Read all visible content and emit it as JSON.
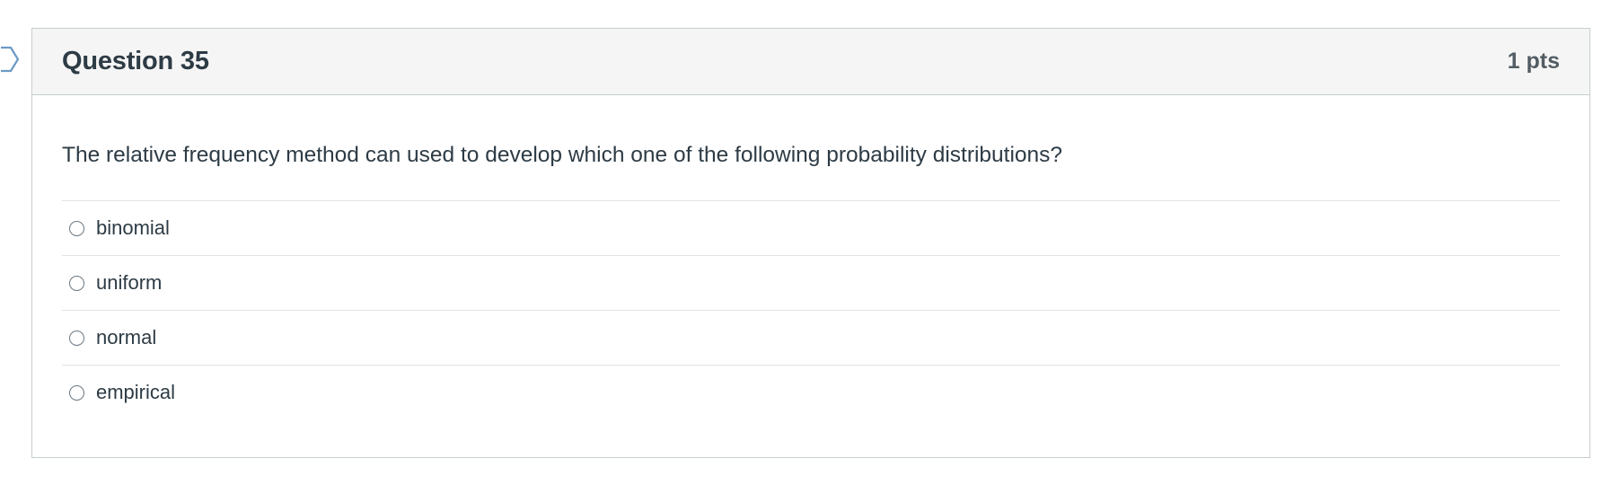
{
  "question": {
    "title": "Question 35",
    "points": "1 pts",
    "text": "The relative frequency method can used to develop which one of the following probability distributions?"
  },
  "answers": [
    {
      "label": "binomial",
      "selected": false
    },
    {
      "label": "uniform",
      "selected": false
    },
    {
      "label": "normal",
      "selected": false
    },
    {
      "label": "empirical",
      "selected": false
    }
  ],
  "colors": {
    "header_bg": "#f5f5f5",
    "border": "#c7cdd1",
    "text": "#2d3b45",
    "points_text": "#525c63",
    "flag_outline": "#6b9ac4"
  },
  "icons": {
    "flag": "flag-question-icon",
    "radio": "radio-unchecked-icon"
  }
}
